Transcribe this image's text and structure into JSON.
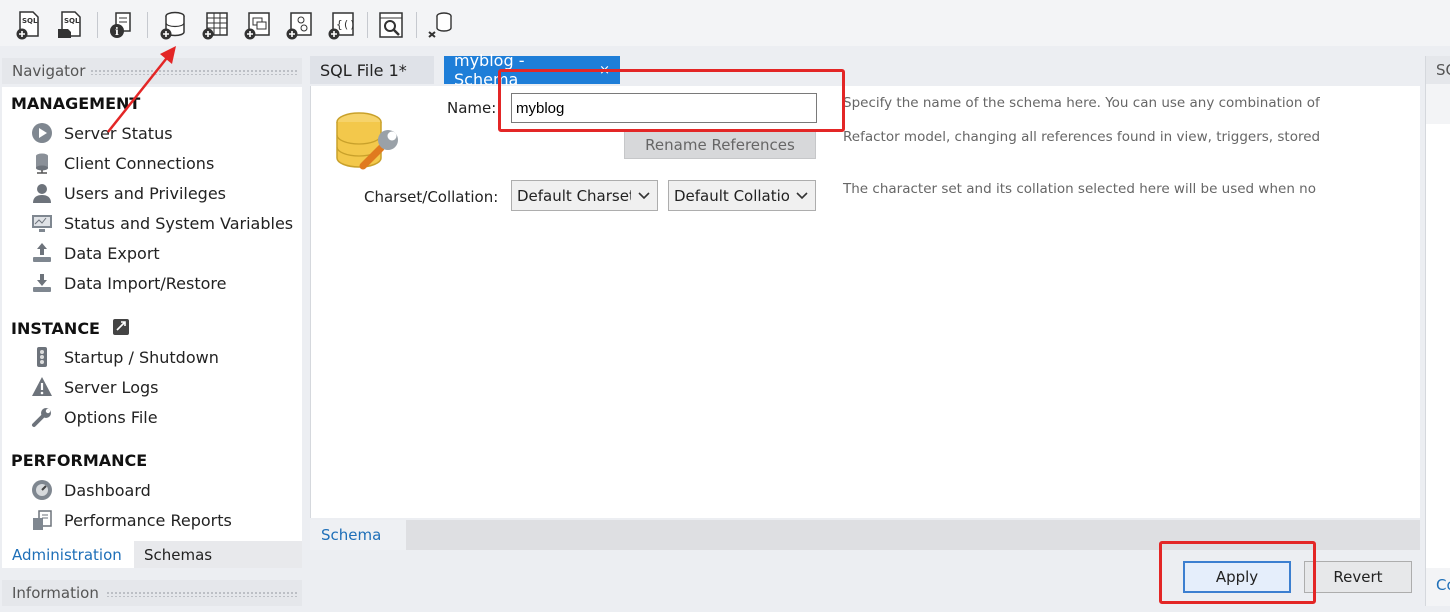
{
  "toolbar": {
    "buttons": [
      {
        "name": "new-sql-tab-button",
        "icon": "sql-add-icon",
        "text": "SQL"
      },
      {
        "name": "open-sql-script-button",
        "icon": "sql-open-icon",
        "text": "SQL"
      },
      {
        "name": "inspector-button",
        "icon": "info-icon"
      },
      {
        "name": "create-schema-button",
        "icon": "database-add-icon"
      },
      {
        "name": "create-table-button",
        "icon": "table-add-icon"
      },
      {
        "name": "create-view-button",
        "icon": "view-add-icon"
      },
      {
        "name": "create-procedure-button",
        "icon": "procedure-add-icon"
      },
      {
        "name": "create-function-button",
        "icon": "function-add-icon"
      },
      {
        "name": "search-table-data-button",
        "icon": "search-data-icon"
      },
      {
        "name": "reconnect-button",
        "icon": "reconnect-icon"
      }
    ]
  },
  "navigator": {
    "title": "Navigator",
    "management": {
      "title": "MANAGEMENT",
      "items": [
        {
          "label": "Server Status",
          "icon": "server-status-icon"
        },
        {
          "label": "Client Connections",
          "icon": "client-connections-icon"
        },
        {
          "label": "Users and Privileges",
          "icon": "user-icon"
        },
        {
          "label": "Status and System Variables",
          "icon": "monitor-icon"
        },
        {
          "label": "Data Export",
          "icon": "export-icon"
        },
        {
          "label": "Data Import/Restore",
          "icon": "import-icon"
        }
      ]
    },
    "instance": {
      "title": "INSTANCE",
      "items": [
        {
          "label": "Startup / Shutdown",
          "icon": "startup-icon"
        },
        {
          "label": "Server Logs",
          "icon": "warning-icon"
        },
        {
          "label": "Options File",
          "icon": "wrench-icon"
        }
      ]
    },
    "performance": {
      "title": "PERFORMANCE",
      "items": [
        {
          "label": "Dashboard",
          "icon": "dashboard-icon"
        },
        {
          "label": "Performance Reports",
          "icon": "reports-icon"
        }
      ]
    },
    "tabs": [
      "Administration",
      "Schemas"
    ]
  },
  "information": {
    "title": "Information"
  },
  "editor": {
    "tabs": [
      {
        "label": "SQL File 1*"
      },
      {
        "label": "myblog - Schema",
        "close": "×"
      }
    ],
    "name_label": "Name:",
    "name_value": "myblog",
    "name_hint": "Specify the name of the schema here. You can use any combination of",
    "rename_button": "Rename References",
    "rename_hint": "Refactor model, changing all references found in view, triggers, stored",
    "charset_label": "Charset/Collation:",
    "charset_value": "Default Charset",
    "collation_value": "Default Collation",
    "charset_hint": "The character set and its collation selected here will be used when no",
    "bottom_tab": "Schema"
  },
  "footer": {
    "apply": "Apply",
    "revert": "Revert"
  },
  "right_panel": {
    "title": "SQ",
    "footer": "Co"
  },
  "colors": {
    "accent": "#1e7ed8",
    "annotation_red": "#e32626"
  }
}
